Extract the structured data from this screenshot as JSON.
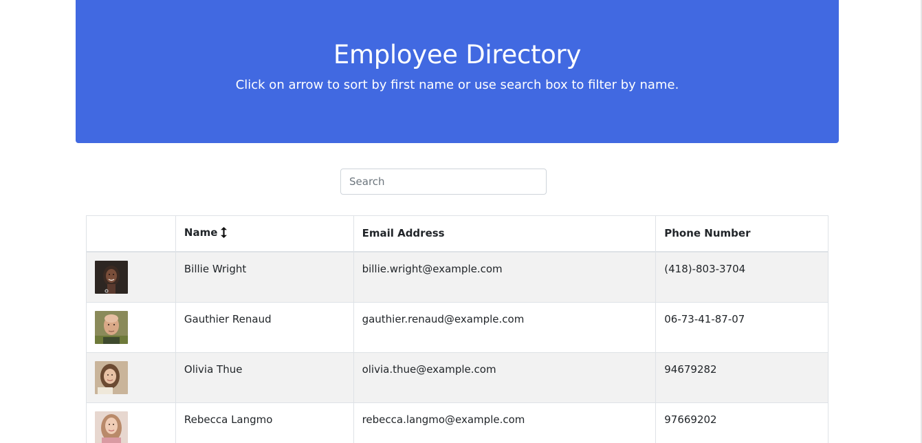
{
  "header": {
    "title": "Employee Directory",
    "subtitle": "Click on arrow to sort by first name or use search box to filter by name."
  },
  "search": {
    "value": "",
    "placeholder": "Search"
  },
  "table": {
    "columns": {
      "image": "",
      "name": "Name",
      "email": "Email Address",
      "phone": "Phone Number"
    },
    "sort_icon": "up-down-arrow-icon",
    "rows": [
      {
        "name": "Billie Wright",
        "email": "billie.wright@example.com",
        "phone": "(418)-803-3704",
        "avatar": "avatar-icon"
      },
      {
        "name": "Gauthier Renaud",
        "email": "gauthier.renaud@example.com",
        "phone": "06-73-41-87-07",
        "avatar": "avatar-icon"
      },
      {
        "name": "Olivia Thue",
        "email": "olivia.thue@example.com",
        "phone": "94679282",
        "avatar": "avatar-icon"
      },
      {
        "name": "Rebecca Langmo",
        "email": "rebecca.langmo@example.com",
        "phone": "97669202",
        "avatar": "avatar-icon"
      }
    ]
  },
  "colors": {
    "header_bg": "#4169e1",
    "header_text": "#ffffff",
    "row_stripe": "#f2f2f2",
    "border": "#dee2e6"
  }
}
